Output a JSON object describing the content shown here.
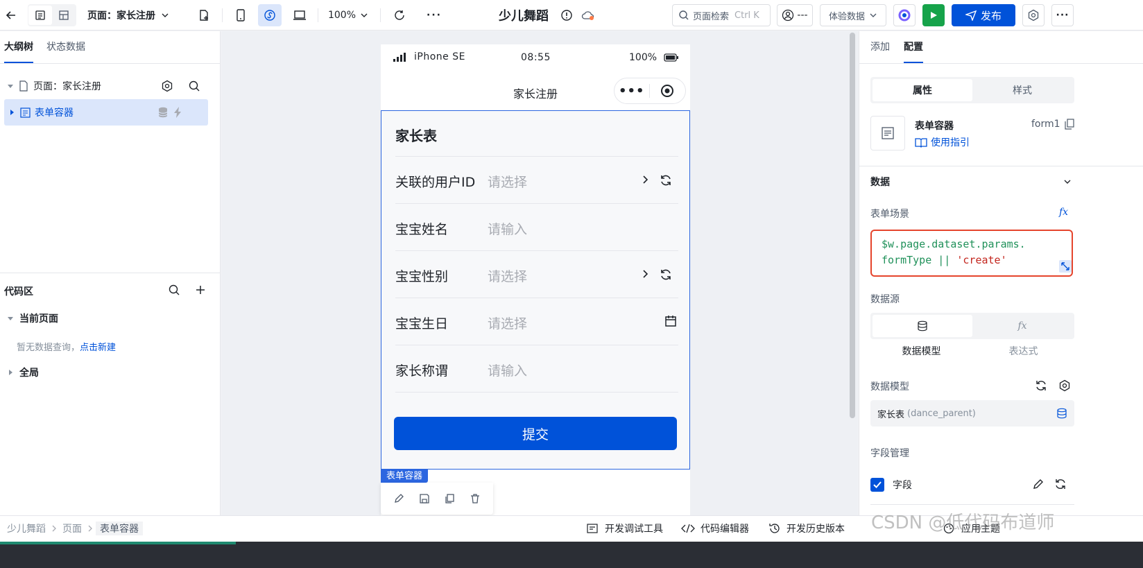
{
  "toolbar": {
    "page_label": "页面：家长注册",
    "zoom": "100%",
    "app_title": "少儿舞蹈",
    "search_placeholder": "页面检索",
    "search_shortcut": "Ctrl K",
    "user_text": "---",
    "experience_data": "体验数据",
    "publish_label": "发布"
  },
  "left": {
    "tabs": [
      {
        "label": "大纲树"
      },
      {
        "label": "状态数据"
      }
    ],
    "tree": {
      "page_node": "页面：家长注册",
      "form_node": "表单容器"
    },
    "code_area": {
      "title": "代码区",
      "current_page": "当前页面",
      "empty_text": "暂无数据查询，",
      "create_link": "点击新建",
      "global": "全局"
    }
  },
  "phone": {
    "device": "iPhone SE",
    "time": "08:55",
    "battery": "100%",
    "nav_title": "家长注册",
    "form_title": "家长表",
    "fields": [
      {
        "label": "关联的用户ID",
        "placeholder": "请选择"
      },
      {
        "label": "宝宝姓名",
        "placeholder": "请输入"
      },
      {
        "label": "宝宝性别",
        "placeholder": "请选择"
      },
      {
        "label": "宝宝生日",
        "placeholder": "请选择"
      },
      {
        "label": "家长称谓",
        "placeholder": "请输入"
      }
    ],
    "submit": "提交",
    "selection_tag": "表单容器"
  },
  "right": {
    "tabs": [
      {
        "label": "添加"
      },
      {
        "label": "配置"
      }
    ],
    "segment": [
      "属性",
      "样式"
    ],
    "component_name": "表单容器",
    "component_id": "form1",
    "guide_link": "使用指引",
    "section_data": "数据",
    "form_scene_label": "表单场景",
    "fx": "fx",
    "expr_line1": "$w.page.dataset.params.",
    "expr_line2_a": "formType ||",
    "expr_line2_b": "'create'",
    "datasource_label": "数据源",
    "ds_options": [
      "数据模型",
      "表达式"
    ],
    "data_model_label": "数据模型",
    "data_model_value": "家长表",
    "data_model_key": "(dance_parent)",
    "field_mgmt_label": "字段管理",
    "fields_checkbox": "字段"
  },
  "bottom": {
    "breadcrumb": [
      "少儿舞蹈",
      "页面",
      "表单容器"
    ],
    "debug_tool": "开发调试工具",
    "code_editor": "代码编辑器",
    "history": "开发历史版本",
    "theme": "应用主题"
  },
  "watermark": "CSDN @低代码布道师",
  "colors": {
    "primary": "#0052d9",
    "border": "#e5e6eb",
    "highlight": "#dbe6fb",
    "string": "#c3261e",
    "code": "#20915a"
  }
}
